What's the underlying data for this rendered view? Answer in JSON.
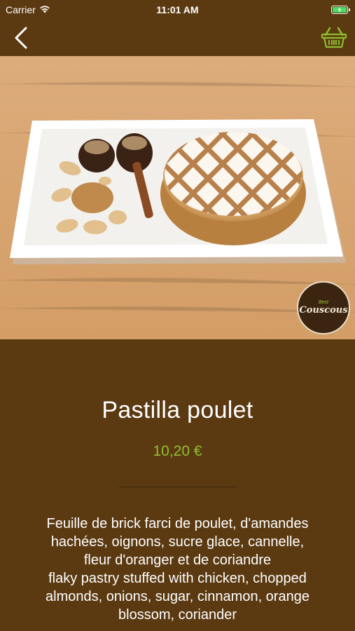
{
  "status_bar": {
    "carrier": "Carrier",
    "time": "11:01 AM"
  },
  "nav": {
    "back_icon": "chevron-left-icon",
    "cart_icon": "shopping-basket-icon",
    "cart_color": "#8fbf2e"
  },
  "hero": {
    "image": "pastilla-dish-photo"
  },
  "logo": {
    "small_text": "Best",
    "main_text": "Couscous"
  },
  "product": {
    "title": "Pastilla poulet",
    "price": "10,20 €",
    "description_lines": [
      "Feuille de brick farci de poulet, d'amandes",
      "hachées, oignons, sucre glace, cannelle,",
      "fleur d'oranger et de coriandre",
      "flaky pastry stuffed with chicken, chopped",
      "almonds, onions, sugar, cinnamon, orange",
      "blossom, coriander"
    ]
  },
  "colors": {
    "background": "#5b3a12",
    "price": "#8fbf2e"
  }
}
